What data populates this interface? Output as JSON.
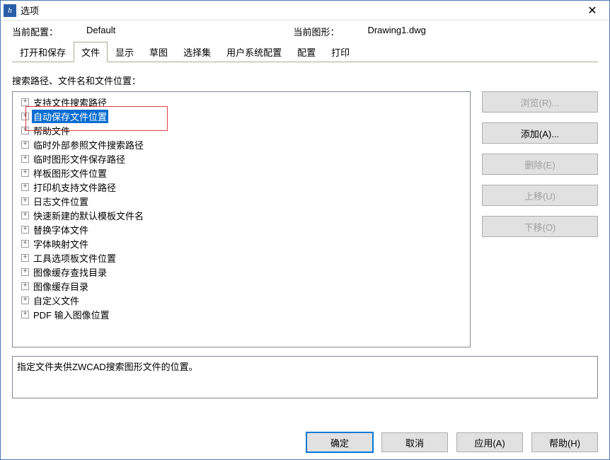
{
  "title": "选项",
  "info": {
    "currentProfileLabel": "当前配置：",
    "currentProfileValue": "Default",
    "currentDrawingLabel": "当前图形：",
    "currentDrawingValue": "Drawing1.dwg"
  },
  "tabs": [
    "打开和保存",
    "文件",
    "显示",
    "草图",
    "选择集",
    "用户系统配置",
    "配置",
    "打印"
  ],
  "activeTab": 1,
  "contentLabel": "搜索路径、文件名和文件位置：",
  "treeItems": [
    {
      "label": "支持文件搜索路径",
      "selected": false
    },
    {
      "label": "自动保存文件位置",
      "selected": true
    },
    {
      "label": "帮助文件",
      "selected": false
    },
    {
      "label": "临时外部参照文件搜索路径",
      "selected": false
    },
    {
      "label": "临时图形文件保存路径",
      "selected": false
    },
    {
      "label": "样板图形文件位置",
      "selected": false
    },
    {
      "label": "打印机支持文件路径",
      "selected": false
    },
    {
      "label": "日志文件位置",
      "selected": false
    },
    {
      "label": "快速新建的默认模板文件名",
      "selected": false
    },
    {
      "label": "替换字体文件",
      "selected": false
    },
    {
      "label": "字体映射文件",
      "selected": false
    },
    {
      "label": "工具选项板文件位置",
      "selected": false
    },
    {
      "label": "图像缓存查找目录",
      "selected": false
    },
    {
      "label": "图像缓存目录",
      "selected": false
    },
    {
      "label": "自定义文件",
      "selected": false
    },
    {
      "label": "PDF 输入图像位置",
      "selected": false
    }
  ],
  "sideButtons": [
    {
      "label": "浏览(R)...",
      "disabled": true
    },
    {
      "label": "添加(A)...",
      "disabled": false
    },
    {
      "label": "删除(E)",
      "disabled": true
    },
    {
      "label": "上移(U)",
      "disabled": true
    },
    {
      "label": "下移(O)",
      "disabled": true
    }
  ],
  "description": "指定文件夹供ZWCAD搜索图形文件的位置。",
  "bottomButtons": {
    "ok": "确定",
    "cancel": "取消",
    "apply": "应用(A)",
    "help": "帮助(H)"
  }
}
